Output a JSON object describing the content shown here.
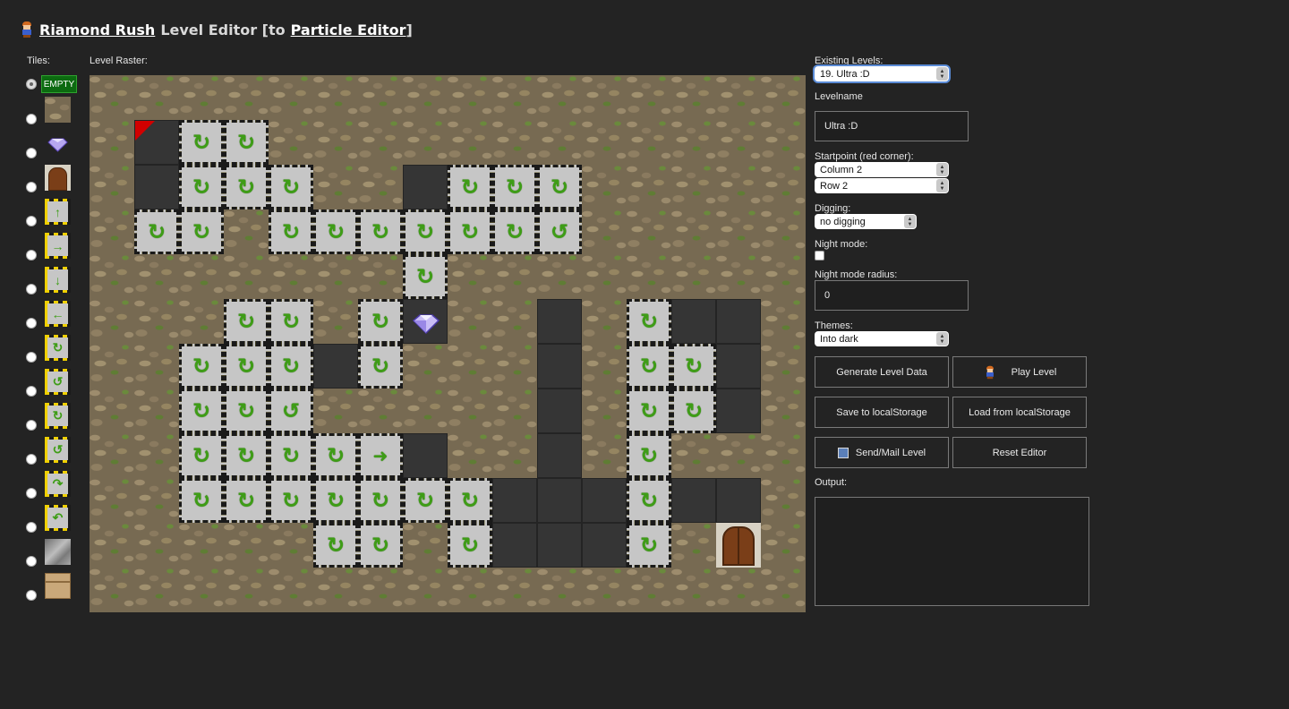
{
  "header": {
    "app_link": "Riamond Rush",
    "title_text": "Level Editor [to",
    "particle_link": "Particle Editor",
    "close_bracket": "]"
  },
  "labels": {
    "tiles": "Tiles:",
    "raster": "Level Raster:",
    "existing_levels": "Existing Levels:",
    "levelname": "Levelname",
    "startpoint": "Startpoint (red corner):",
    "digging": "Digging:",
    "night_mode": "Night mode:",
    "night_radius": "Night mode radius:",
    "themes": "Themes:",
    "output": "Output:"
  },
  "tiles": {
    "empty_label": "EMPTY",
    "items": [
      "empty",
      "stone",
      "diamond",
      "door",
      "arrow-up",
      "arrow-right",
      "arrow-down",
      "arrow-left",
      "rotate-1",
      "rotate-2",
      "rotate-3",
      "rotate-4",
      "rotate-5",
      "rotate-6",
      "cloud",
      "crate"
    ],
    "selected": "empty"
  },
  "form": {
    "existing_level": "19. Ultra :D",
    "levelname": "Ultra :D",
    "start_column": "Column 2",
    "start_row": "Row 2",
    "digging": "no digging",
    "night_mode": false,
    "night_radius": "0",
    "theme": "Into dark"
  },
  "buttons": {
    "generate": "Generate Level Data",
    "play": "Play Level",
    "save": "Save to localStorage",
    "load": "Load from localStorage",
    "send": "Send/Mail Level",
    "reset": "Reset Editor"
  },
  "grid": {
    "cols": 16,
    "rows": 12,
    "cells": [
      {
        "c": 1,
        "r": 1,
        "t": "dark",
        "start": true
      },
      {
        "c": 2,
        "r": 1,
        "t": "dashed",
        "i": "rot"
      },
      {
        "c": 3,
        "r": 1,
        "t": "dashed",
        "i": "rot"
      },
      {
        "c": 1,
        "r": 2,
        "t": "dark"
      },
      {
        "c": 2,
        "r": 2,
        "t": "dashed",
        "i": "rotb"
      },
      {
        "c": 3,
        "r": 2,
        "t": "dashed",
        "i": "rotc"
      },
      {
        "c": 4,
        "r": 2,
        "t": "dashed",
        "i": "rotb"
      },
      {
        "c": 7,
        "r": 2,
        "t": "dark"
      },
      {
        "c": 8,
        "r": 2,
        "t": "dashed",
        "i": "rotc"
      },
      {
        "c": 9,
        "r": 2,
        "t": "dashed",
        "i": "rotc"
      },
      {
        "c": 10,
        "r": 2,
        "t": "dashed",
        "i": "rotb"
      },
      {
        "c": 1,
        "r": 3,
        "t": "dashed",
        "i": "rotc"
      },
      {
        "c": 2,
        "r": 3,
        "t": "dashed",
        "i": "rotc"
      },
      {
        "c": 4,
        "r": 3,
        "t": "dashed",
        "i": "rotc"
      },
      {
        "c": 5,
        "r": 3,
        "t": "dashed",
        "i": "rotc"
      },
      {
        "c": 6,
        "r": 3,
        "t": "dashed",
        "i": "rotc"
      },
      {
        "c": 7,
        "r": 3,
        "t": "dashed",
        "i": "rotc"
      },
      {
        "c": 8,
        "r": 3,
        "t": "dashed",
        "i": "rotc"
      },
      {
        "c": 9,
        "r": 3,
        "t": "dashed",
        "i": "rotc"
      },
      {
        "c": 10,
        "r": 3,
        "t": "dashed",
        "i": "rotd"
      },
      {
        "c": 7,
        "r": 4,
        "t": "dashed",
        "i": "rotb"
      },
      {
        "c": 3,
        "r": 5,
        "t": "dashed",
        "i": "rot"
      },
      {
        "c": 4,
        "r": 5,
        "t": "dashed",
        "i": "rot"
      },
      {
        "c": 6,
        "r": 5,
        "t": "dashed",
        "i": "rotc"
      },
      {
        "c": 7,
        "r": 5,
        "t": "dark",
        "i": "diamond"
      },
      {
        "c": 10,
        "r": 5,
        "t": "dark"
      },
      {
        "c": 12,
        "r": 5,
        "t": "dashed",
        "i": "rot"
      },
      {
        "c": 13,
        "r": 5,
        "t": "dark"
      },
      {
        "c": 14,
        "r": 5,
        "t": "dark"
      },
      {
        "c": 2,
        "r": 6,
        "t": "dashed",
        "i": "rotc"
      },
      {
        "c": 3,
        "r": 6,
        "t": "dashed",
        "i": "rotb"
      },
      {
        "c": 4,
        "r": 6,
        "t": "dashed",
        "i": "rotc"
      },
      {
        "c": 5,
        "r": 6,
        "t": "dark"
      },
      {
        "c": 6,
        "r": 6,
        "t": "dashed",
        "i": "rotb"
      },
      {
        "c": 10,
        "r": 6,
        "t": "dark"
      },
      {
        "c": 12,
        "r": 6,
        "t": "dashed",
        "i": "rotb"
      },
      {
        "c": 13,
        "r": 6,
        "t": "dashed",
        "i": "rotc"
      },
      {
        "c": 14,
        "r": 6,
        "t": "dark"
      },
      {
        "c": 2,
        "r": 7,
        "t": "dashed",
        "i": "rotc"
      },
      {
        "c": 3,
        "r": 7,
        "t": "dashed",
        "i": "rot"
      },
      {
        "c": 4,
        "r": 7,
        "t": "dashed",
        "i": "rotd"
      },
      {
        "c": 10,
        "r": 7,
        "t": "dark"
      },
      {
        "c": 12,
        "r": 7,
        "t": "dashed",
        "i": "rotb"
      },
      {
        "c": 13,
        "r": 7,
        "t": "dashed",
        "i": "rotc"
      },
      {
        "c": 14,
        "r": 7,
        "t": "dark"
      },
      {
        "c": 2,
        "r": 8,
        "t": "dashed",
        "i": "rotc"
      },
      {
        "c": 3,
        "r": 8,
        "t": "dashed",
        "i": "rotb"
      },
      {
        "c": 4,
        "r": 8,
        "t": "dashed",
        "i": "rotb"
      },
      {
        "c": 5,
        "r": 8,
        "t": "dashed",
        "i": "rot"
      },
      {
        "c": 6,
        "r": 8,
        "t": "dashed",
        "i": "right"
      },
      {
        "c": 7,
        "r": 8,
        "t": "dark"
      },
      {
        "c": 10,
        "r": 8,
        "t": "dark"
      },
      {
        "c": 12,
        "r": 8,
        "t": "dashed",
        "i": "rotb"
      },
      {
        "c": 2,
        "r": 9,
        "t": "dashed",
        "i": "rotc"
      },
      {
        "c": 3,
        "r": 9,
        "t": "dashed",
        "i": "rotb"
      },
      {
        "c": 4,
        "r": 9,
        "t": "dashed",
        "i": "rotc"
      },
      {
        "c": 5,
        "r": 9,
        "t": "dashed",
        "i": "rotc"
      },
      {
        "c": 6,
        "r": 9,
        "t": "dashed",
        "i": "rotb"
      },
      {
        "c": 7,
        "r": 9,
        "t": "dashed",
        "i": "rotb"
      },
      {
        "c": 8,
        "r": 9,
        "t": "dashed",
        "i": "rot"
      },
      {
        "c": 9,
        "r": 9,
        "t": "dark"
      },
      {
        "c": 10,
        "r": 9,
        "t": "dark"
      },
      {
        "c": 11,
        "r": 9,
        "t": "dark"
      },
      {
        "c": 12,
        "r": 9,
        "t": "dashed",
        "i": "rotb"
      },
      {
        "c": 13,
        "r": 9,
        "t": "dark"
      },
      {
        "c": 14,
        "r": 9,
        "t": "dark"
      },
      {
        "c": 5,
        "r": 10,
        "t": "dashed",
        "i": "rotc"
      },
      {
        "c": 6,
        "r": 10,
        "t": "dashed",
        "i": "rotb"
      },
      {
        "c": 8,
        "r": 10,
        "t": "dashed",
        "i": "rotc"
      },
      {
        "c": 9,
        "r": 10,
        "t": "dark"
      },
      {
        "c": 10,
        "r": 10,
        "t": "dark"
      },
      {
        "c": 11,
        "r": 10,
        "t": "dark"
      },
      {
        "c": 12,
        "r": 10,
        "t": "dashed",
        "i": "rotb"
      },
      {
        "c": 14,
        "r": 10,
        "t": "door"
      }
    ]
  },
  "colors": {
    "accent_focus": "#5a8bd6",
    "path_yellow": "#f2d400",
    "arrow_green": "#3e9d16",
    "start_red": "#d20000"
  }
}
